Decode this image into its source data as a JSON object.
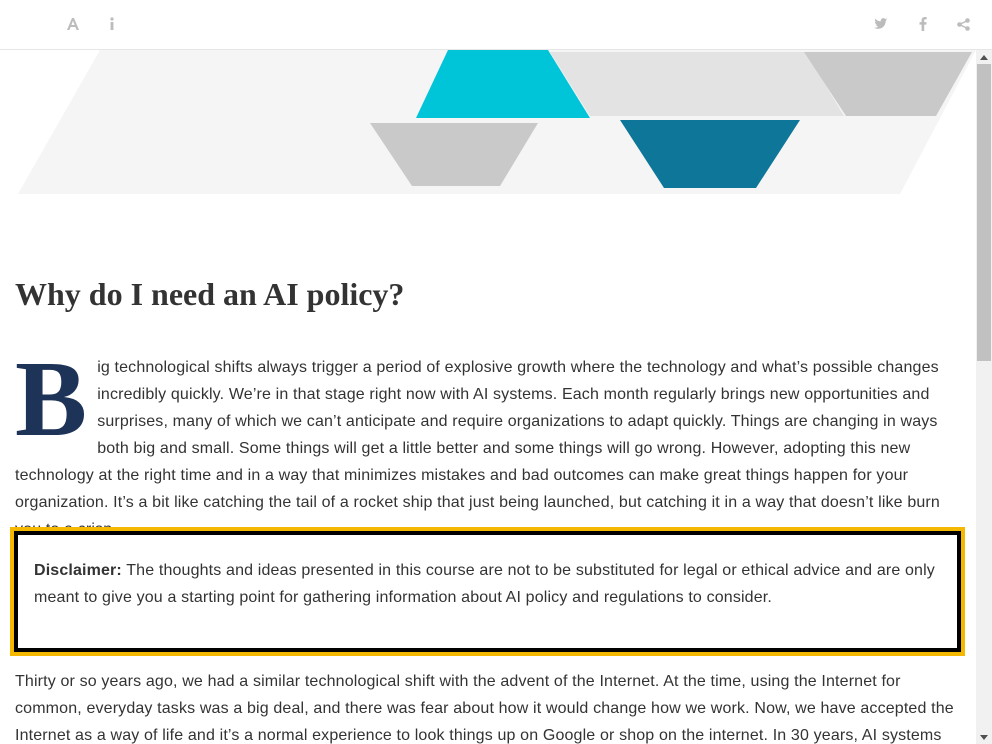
{
  "topbar": {
    "left_icons": [
      "font-size-icon",
      "info-icon"
    ],
    "right_icons": [
      "twitter-icon",
      "facebook-icon",
      "share-icon"
    ]
  },
  "hero": {
    "colors": {
      "cyan": "#00c4d8",
      "teal": "#0e7699",
      "gray": "#c9c9c9",
      "light_gray": "#e3e3e3",
      "band": "#f5f5f5"
    }
  },
  "article": {
    "title": "Why do I need an AI policy?",
    "dropcap": "B",
    "paragraph1": "ig technological shifts always trigger a period of explosive growth where the technology and what’s possible changes incredibly quickly. We’re in that stage right now with AI systems. Each month regularly brings new opportunities and surprises, many of which we can’t anticipate and require organizations to adapt quickly. Things are changing in ways both big and small. Some things will get a little better and some things will go wrong. However, adopting this new technology at the right time and in a way that minimizes mistakes and bad outcomes can make great things happen for your organization. It’s a bit like catching the tail of a rocket ship that just being launched, but catching it in a way that doesn’t like burn you to a crisp.",
    "disclaimer_label": "Disclaimer:",
    "disclaimer_text": " The thoughts and ideas presented in this course are not to be substituted for legal or ethical advice and are only meant to give you a starting point for gathering information about AI policy and regulations to consider.",
    "paragraph2": "Thirty or so years ago, we had a similar technological shift with the advent of the Internet. At the time, using the Internet for common, everyday tasks was a big deal, and there was fear about how it would change how we work. Now, we have accepted the Internet as a way of life and it’s a normal experience to look things up on Google or shop on the internet. In 30 years, AI systems"
  },
  "colors": {
    "dropcap": "#1e3358",
    "callout_border": "#f5b800",
    "text": "#333333"
  },
  "scrollbar": {
    "position_fraction": 0.0
  }
}
